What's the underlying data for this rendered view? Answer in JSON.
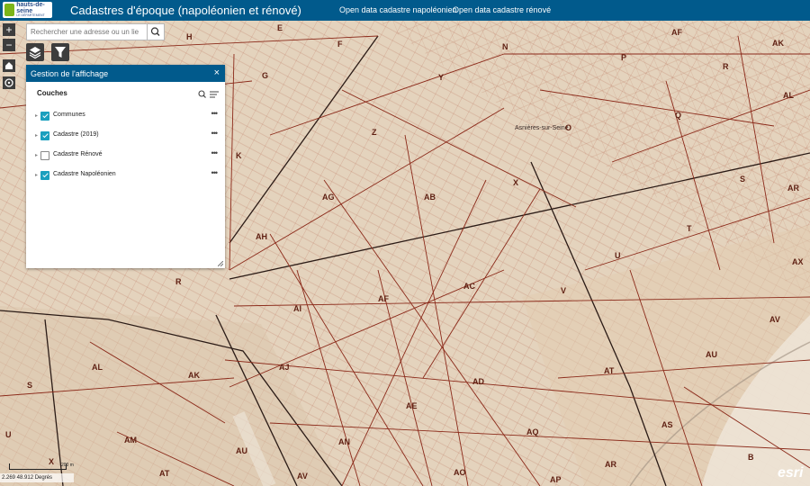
{
  "header": {
    "logo_text": "hauts-de-seine",
    "logo_subtext": "LE DÉPARTEMENT",
    "title": "Cadastres d'époque (napoléonien et rénové)",
    "links": [
      "Open data cadastre napoléonien",
      "Open data cadastre rénové"
    ]
  },
  "search": {
    "placeholder": "Rechercher une adresse ou un lie"
  },
  "panel": {
    "title": "Gestion de l'affichage",
    "close": "×",
    "section": "Couches",
    "layers": [
      {
        "label": "Communes",
        "checked": true,
        "more": "•••"
      },
      {
        "label": "Cadastre (2019)",
        "checked": true,
        "more": "•••"
      },
      {
        "label": "Cadastre Rénové",
        "checked": false,
        "more": "•••"
      },
      {
        "label": "Cadastre Napoléonien",
        "checked": true,
        "more": "•••"
      }
    ]
  },
  "zoom": {
    "in": "+",
    "out": "−"
  },
  "map": {
    "place_name": "Asnières-sur-Seine",
    "parcel_labels": [
      "H",
      "E",
      "F",
      "N",
      "AF",
      "AK",
      "G",
      "P",
      "R",
      "Y",
      "AL",
      "Z",
      "Q",
      "O",
      "K",
      "X",
      "S",
      "AR",
      "AG",
      "AB",
      "T",
      "AH",
      "U",
      "AX",
      "R",
      "AF",
      "AC",
      "V",
      "AI",
      "AV",
      "AL",
      "AK",
      "AJ",
      "AD",
      "AT",
      "AU",
      "S",
      "AE",
      "AS",
      "AM",
      "AN",
      "AQ",
      "U",
      "X",
      "AU",
      "AT",
      "AV",
      "AO",
      "AP",
      "AR",
      "B"
    ]
  },
  "scale": {
    "label": "200 m"
  },
  "coordinates": "2.269 48.912 Degrés",
  "attribution": "esri",
  "colors": {
    "header": "#015a8c",
    "checkbox": "#1a9fbe",
    "parcel_line": "#8b2a1a",
    "map_bg": "#e7d7c3"
  }
}
